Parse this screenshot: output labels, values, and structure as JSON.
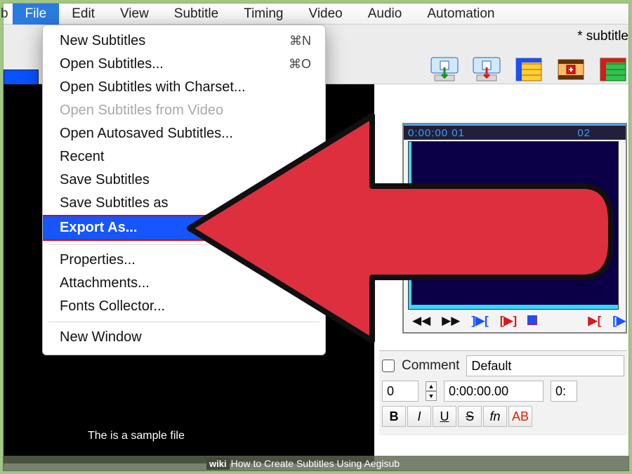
{
  "menubar": {
    "suffix": "b",
    "items": [
      "File",
      "Edit",
      "View",
      "Subtitle",
      "Timing",
      "Video",
      "Audio",
      "Automation"
    ],
    "active": 0
  },
  "title": {
    "text": "* subtitle"
  },
  "dropdown": {
    "groups": [
      [
        {
          "label": "New Subtitles",
          "shortcut": "⌘N",
          "disabled": false
        },
        {
          "label": "Open Subtitles...",
          "shortcut": "⌘O",
          "disabled": false
        },
        {
          "label": "Open Subtitles with Charset...",
          "disabled": false
        },
        {
          "label": "Open Subtitles from Video",
          "disabled": true
        },
        {
          "label": "Open Autosaved Subtitles...",
          "disabled": false
        },
        {
          "label": "Recent",
          "sub": true
        },
        {
          "label": "Save Subtitles"
        },
        {
          "label": "Save Subtitles as"
        },
        {
          "label": "Export As...",
          "hot": true
        }
      ],
      [
        {
          "label": "Properties..."
        },
        {
          "label": "Attachments..."
        },
        {
          "label": "Fonts Collector..."
        }
      ],
      [
        {
          "label": "New Window"
        }
      ]
    ]
  },
  "timeline": {
    "t0": "0:00:00 01",
    "t1": "02"
  },
  "edit": {
    "commentLabel": "Comment",
    "styleValue": "Default",
    "number": "0",
    "start": "0:00:00.00",
    "end": "0:",
    "fmt": {
      "b": "B",
      "i": "I",
      "u": "U",
      "s": "S",
      "fn": "fn",
      "ab": "AB"
    }
  },
  "sample": "The is a sample file",
  "tool_icons": [
    "paste-to-track-icon",
    "apply-to-track-icon",
    "timing-table-icon",
    "shift-times-icon",
    "style-table-icon"
  ],
  "caption": {
    "brand": "wiki",
    "text": "How to Create Subtitles Using Aegisub"
  }
}
